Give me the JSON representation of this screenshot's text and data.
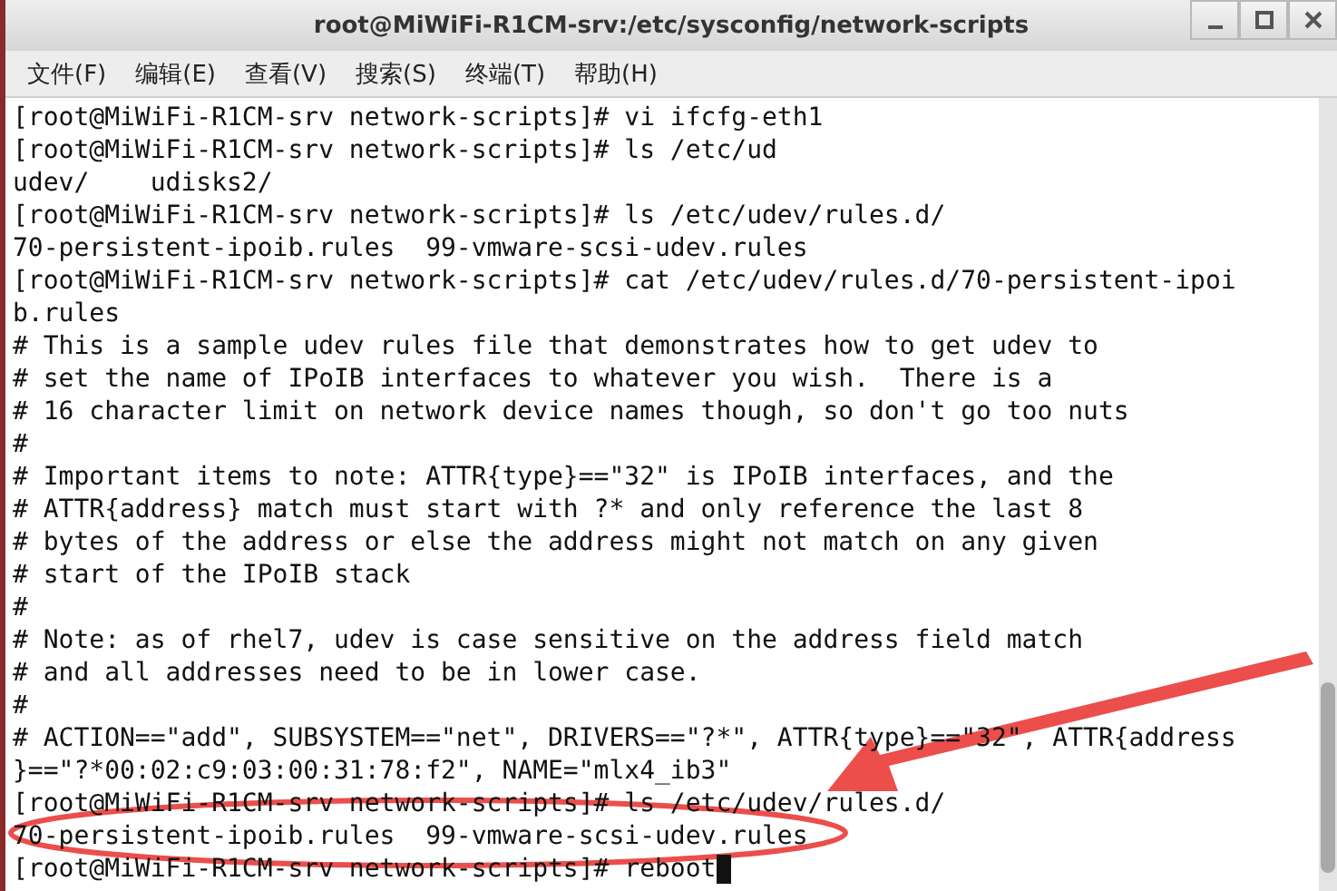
{
  "window": {
    "title": "root@MiWiFi-R1CM-srv:/etc/sysconfig/network-scripts"
  },
  "menu": [
    "文件(F)",
    "编辑(E)",
    "查看(V)",
    "搜索(S)",
    "终端(T)",
    "帮助(H)"
  ],
  "terminal": {
    "cursor_visible": true,
    "lines": [
      "[root@MiWiFi-R1CM-srv network-scripts]# vi ifcfg-eth1",
      "[root@MiWiFi-R1CM-srv network-scripts]# ls /etc/ud",
      "udev/    udisks2/",
      "[root@MiWiFi-R1CM-srv network-scripts]# ls /etc/udev/rules.d/",
      "70-persistent-ipoib.rules  99-vmware-scsi-udev.rules",
      "[root@MiWiFi-R1CM-srv network-scripts]# cat /etc/udev/rules.d/70-persistent-ipoi",
      "b.rules",
      "# This is a sample udev rules file that demonstrates how to get udev to",
      "# set the name of IPoIB interfaces to whatever you wish.  There is a",
      "# 16 character limit on network device names though, so don't go too nuts",
      "#",
      "# Important items to note: ATTR{type}==\"32\" is IPoIB interfaces, and the",
      "# ATTR{address} match must start with ?* and only reference the last 8",
      "# bytes of the address or else the address might not match on any given",
      "# start of the IPoIB stack",
      "#",
      "# Note: as of rhel7, udev is case sensitive on the address field match",
      "# and all addresses need to be in lower case.",
      "#",
      "# ACTION==\"add\", SUBSYSTEM==\"net\", DRIVERS==\"?*\", ATTR{type}==\"32\", ATTR{address",
      "}==\"?*00:02:c9:03:00:31:78:f2\", NAME=\"mlx4_ib3\"",
      "[root@MiWiFi-R1CM-srv network-scripts]# ls /etc/udev/rules.d/",
      "70-persistent-ipoib.rules  99-vmware-scsi-udev.rules",
      "[root@MiWiFi-R1CM-srv network-scripts]# reboot"
    ]
  }
}
